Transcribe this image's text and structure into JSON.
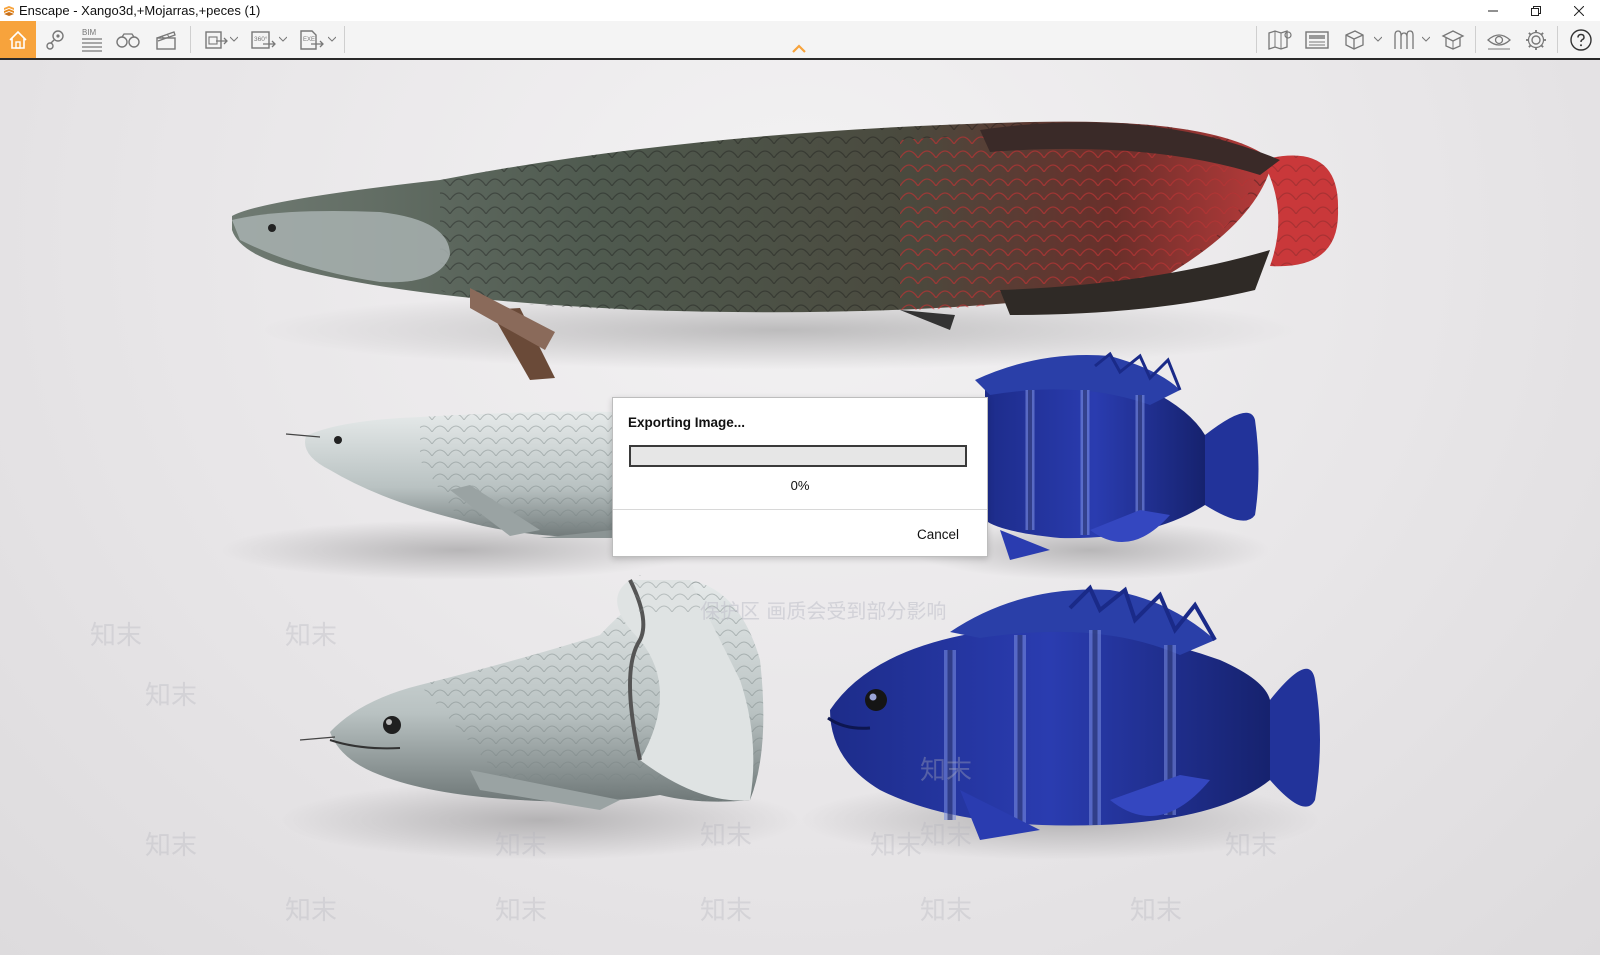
{
  "window": {
    "title": "Enscape - Xango3d,+Mojarras,+peces (1)"
  },
  "toolbar": {
    "left_icons": [
      "home-icon",
      "pin-icon",
      "bim-icon",
      "binoculars-icon",
      "clapperboard-icon",
      "screenshot-export-icon",
      "panorama-360-export-icon",
      "exe-export-icon"
    ],
    "bim_label": "BIM",
    "pano_label": "360°",
    "exe_label": "EXE",
    "right_icons": [
      "map-icon",
      "media-icon",
      "cube-icon",
      "asset-library-icon",
      "material-icon",
      "eye-icon",
      "gear-icon",
      "help-icon"
    ],
    "accent_color": "#f7a33c"
  },
  "watermark": {
    "repeat_text": "知末",
    "banner_text": "保护区 画质会受到部分影响"
  },
  "dialog": {
    "title": "Exporting Image...",
    "progress": 0,
    "percent_text": "0%",
    "cancel_label": "Cancel"
  }
}
